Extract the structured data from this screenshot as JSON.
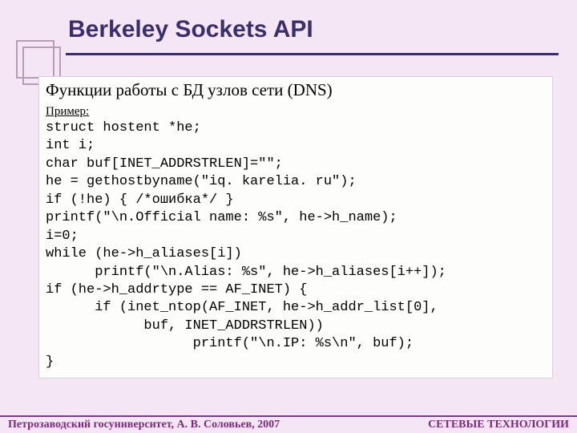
{
  "title": "Berkeley Sockets API",
  "subtitle": "Функции работы с БД узлов сети (DNS)",
  "example_label": "Пример:",
  "code": "struct hostent *he;\nint i;\nchar buf[INET_ADDRSTRLEN]=\"\";\nhe = gethostbyname(\"iq. karelia. ru\");\nif (!he) { /*ошибка*/ }\nprintf(\"\\n.Official name: %s\", he->h_name);\ni=0;\nwhile (he->h_aliases[i])\n      printf(\"\\n.Alias: %s\", he->h_aliases[i++]);\nif (he->h_addrtype == AF_INET) {\n      if (inet_ntop(AF_INET, he->h_addr_list[0],\n            buf, INET_ADDRSTRLEN))\n                  printf(\"\\n.IP: %s\\n\", buf);\n}",
  "footer": {
    "left": "Петрозаводский госуниверситет, А. В. Соловьев, 2007",
    "right": "СЕТЕВЫЕ ТЕХНОЛОГИИ"
  }
}
